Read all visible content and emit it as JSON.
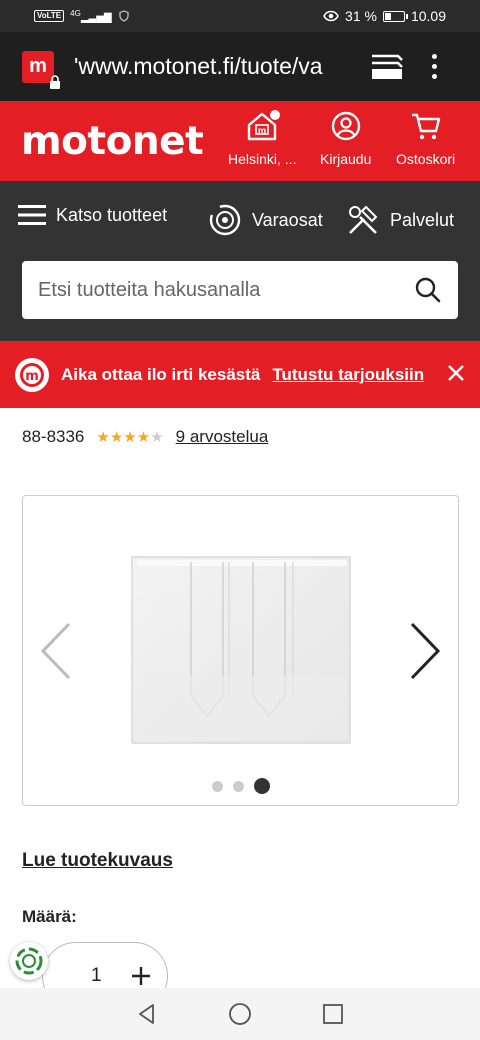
{
  "status_bar": {
    "network": "VoLTE",
    "signal": "4G",
    "battery_percent_label": "31 %",
    "battery_level": 0.31,
    "time": "10.09"
  },
  "browser": {
    "url": "'www.motonet.fi/tuote/va",
    "favicon_letter": "m"
  },
  "header": {
    "logo": "motonet",
    "store_label": "Helsinki, ...",
    "login_label": "Kirjaudu",
    "cart_label": "Ostoskori"
  },
  "nav": {
    "browse_label": "Katso tuotteet",
    "parts_label": "Varaosat",
    "services_label": "Palvelut"
  },
  "search": {
    "placeholder": "Etsi tuotteita hakusanalla"
  },
  "promo": {
    "text": "Aika ottaa ilo irti kesästä",
    "link": "Tutustu tarjouksiin"
  },
  "product": {
    "sku": "88-8336",
    "rating": 4,
    "rating_max": 5,
    "reviews_label": "9 arvostelua",
    "gallery_slide_count": 3,
    "gallery_active_index": 2
  },
  "details": {
    "description_link": "Lue tuotekuvaus",
    "quantity_label": "Määrä:",
    "quantity_value": "1"
  },
  "colors": {
    "brand_red": "#e31e24",
    "dark_bar": "#333333",
    "star": "#f5a623"
  }
}
